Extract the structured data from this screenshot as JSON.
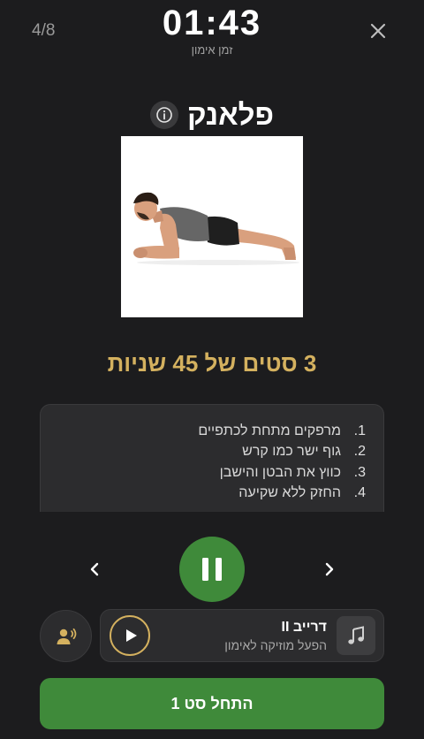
{
  "header": {
    "counter": "4/8",
    "timer": "01:43",
    "timer_label": "זמן אימון"
  },
  "exercise": {
    "title": "פלאנק",
    "sets_text": "3 סטים של 45 שניות",
    "instructions": [
      {
        "num": "1.",
        "text": "מרפקים מתחת לכתפיים"
      },
      {
        "num": "2.",
        "text": "גוף ישר כמו קרש"
      },
      {
        "num": "3.",
        "text": "כווץ את הבטן והישבן"
      },
      {
        "num": "4.",
        "text": "החזק ללא שקיעה"
      }
    ]
  },
  "music": {
    "title": "דרייב II",
    "subtitle": "הפעל מוזיקה לאימון"
  },
  "start_button": "התחל סט 1",
  "colors": {
    "background": "#1c1c1e",
    "accent_gold": "#d4b15f",
    "accent_green": "#3f8a3a",
    "card": "#2c2c2e"
  },
  "icons": [
    "close-icon",
    "info-icon",
    "chevron-left-icon",
    "chevron-right-icon",
    "pause-icon",
    "voice-icon",
    "music-note-icon",
    "play-icon"
  ]
}
